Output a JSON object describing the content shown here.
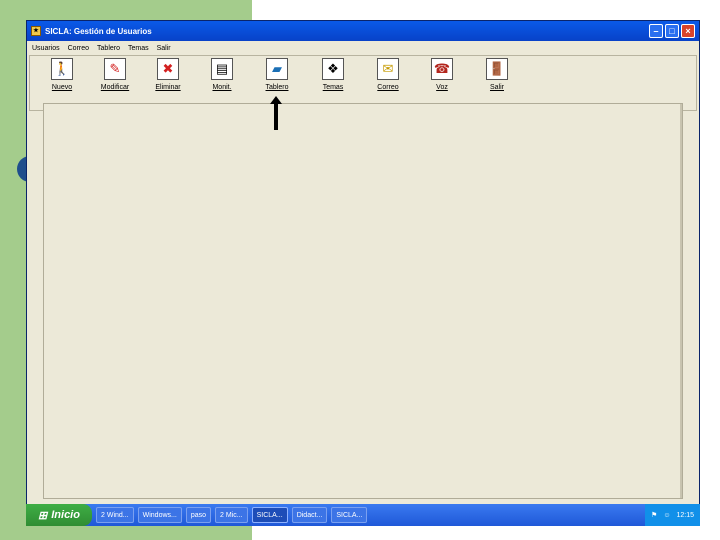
{
  "window": {
    "title": "SICLA: Gestión de Usuarios",
    "menu": [
      "Usuarios",
      "Correo",
      "Tablero",
      "Temas",
      "Salir"
    ],
    "tools": [
      {
        "label": "Nuevo",
        "icon": "new-user-icon"
      },
      {
        "label": "Modificar",
        "icon": "edit-user-icon"
      },
      {
        "label": "Eliminar",
        "icon": "delete-user-icon"
      },
      {
        "label": "Monit.",
        "icon": "monitor-icon"
      },
      {
        "label": "Tablero",
        "icon": "board-icon"
      },
      {
        "label": "Temas",
        "icon": "topics-icon"
      },
      {
        "label": "Correo",
        "icon": "mail-icon"
      },
      {
        "label": "Voz",
        "icon": "voice-icon"
      },
      {
        "label": "Salir",
        "icon": "exit-icon"
      }
    ]
  },
  "taskbar": {
    "start_label": "Inicio",
    "tasks": [
      "2 Wind...",
      "Windows...",
      "paso",
      "2 Mic...",
      "SICLA...",
      "Didact...",
      "SICLA..."
    ],
    "clock": "12:15"
  }
}
